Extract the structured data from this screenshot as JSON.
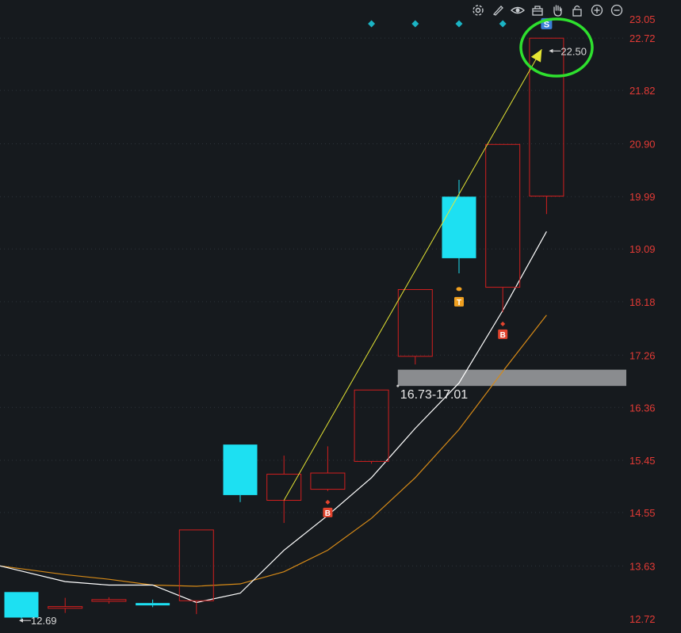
{
  "toolbar": {
    "icons": [
      "gear-icon",
      "pencil-icon",
      "eye-icon",
      "basket-icon",
      "hand-icon",
      "lock-icon",
      "zoom-in-icon",
      "zoom-out-icon"
    ]
  },
  "colors": {
    "background": "#161a1e",
    "grid": "#2e343b",
    "axis_text": "#e23a35",
    "up_candle": "#d11f1f",
    "down_candle": "#1de0f2",
    "ma_short": "#ffffff",
    "ma_long": "#d68a17",
    "trend_line": "#e6e633",
    "zone": "#8a8c8f",
    "circle": "#2ee02e",
    "diamond": "#1bb4c4",
    "buy_marker": "#e2442e",
    "t_marker": "#f0a020",
    "s_marker": "#3b7fd6"
  },
  "chart_data": {
    "type": "candlestick",
    "y_axis": {
      "min": 12.72,
      "max": 23.05,
      "ticks": [
        "23.05",
        "22.72",
        "21.82",
        "20.90",
        "19.99",
        "19.09",
        "18.18",
        "17.26",
        "16.36",
        "15.45",
        "14.55",
        "13.63",
        "12.72"
      ]
    },
    "grid": true,
    "candles": [
      {
        "open": 13.18,
        "close": 12.74,
        "high": 13.18,
        "low": 12.7
      },
      {
        "open": 12.9,
        "close": 12.93,
        "high": 13.08,
        "low": 12.82
      },
      {
        "open": 13.02,
        "close": 13.05,
        "high": 13.09,
        "low": 12.98
      },
      {
        "open": 12.99,
        "close": 12.95,
        "high": 13.05,
        "low": 12.92
      },
      {
        "open": 13.03,
        "close": 14.25,
        "high": 14.25,
        "low": 12.8
      },
      {
        "open": 15.72,
        "close": 14.85,
        "high": 15.72,
        "low": 14.73
      },
      {
        "open": 14.76,
        "close": 15.21,
        "high": 15.53,
        "low": 14.37
      },
      {
        "open": 14.95,
        "close": 15.23,
        "high": 15.69,
        "low": 14.92
      },
      {
        "open": 15.43,
        "close": 16.66,
        "high": 16.66,
        "low": 15.39
      },
      {
        "open": 17.24,
        "close": 18.39,
        "high": 18.39,
        "low": 17.1
      },
      {
        "open": 19.99,
        "close": 18.93,
        "high": 20.28,
        "low": 18.67
      },
      {
        "open": 18.43,
        "close": 20.89,
        "high": 20.89,
        "low": 18.0
      },
      {
        "open": 20.0,
        "close": 22.72,
        "high": 22.72,
        "low": 19.69
      }
    ],
    "ma_short": [
      13.63,
      13.36,
      13.3,
      13.3,
      13.0,
      13.16,
      13.9,
      14.5,
      15.15,
      16.0,
      16.78,
      18.03,
      19.39
    ],
    "ma_long": [
      13.63,
      13.48,
      13.4,
      13.3,
      13.28,
      13.32,
      13.53,
      13.9,
      14.45,
      15.15,
      15.98,
      16.98,
      17.95
    ],
    "trend_line": {
      "from": [
        6,
        14.76
      ],
      "to": [
        12,
        22.57
      ]
    },
    "zone": {
      "low": 16.73,
      "high": 17.01,
      "from_index": 9,
      "label": "16.73-17.01"
    },
    "annotations": [
      {
        "type": "price_tag",
        "index": 12,
        "value": 22.5,
        "text": "22.50"
      },
      {
        "type": "price_tag",
        "index": 0,
        "value": 12.69,
        "text": "12.69"
      },
      {
        "type": "buy_marker",
        "index": 7,
        "value": 14.55,
        "text": "B"
      },
      {
        "type": "buy_marker",
        "index": 11,
        "value": 17.62,
        "text": "B"
      },
      {
        "type": "t_marker",
        "index": 10,
        "value": 18.18,
        "text": "T"
      },
      {
        "type": "s_marker",
        "index": 12,
        "value": 22.97,
        "text": "S"
      }
    ],
    "top_diamonds": [
      8,
      9,
      10,
      11
    ]
  }
}
